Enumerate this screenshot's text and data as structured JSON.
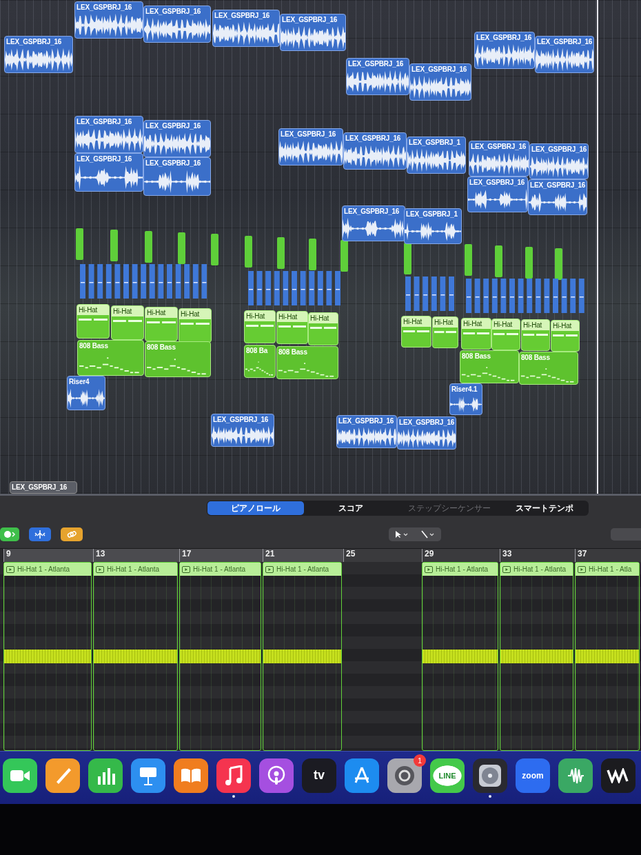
{
  "arrange": {
    "regions": [
      {
        "kind": "audio",
        "name": "LEX_GSPBRJ_16"
      },
      {
        "kind": "audio",
        "name": "LEX_GSPBRJ_16"
      },
      {
        "kind": "audio",
        "name": "LEX_GSPBRJ_16"
      },
      {
        "kind": "audio",
        "name": "LEX_GSPBRJ_16"
      },
      {
        "kind": "audio",
        "name": "LEX_GSPBRJ_16"
      },
      {
        "kind": "audio",
        "name": "LEX_GSPBRJ_16"
      },
      {
        "kind": "audio",
        "name": "LEX_GSPBRJ_16"
      },
      {
        "kind": "audio",
        "name": "LEX_GSPBRJ_16"
      },
      {
        "kind": "audio",
        "name": "LEX_GSPBRJ_16"
      },
      {
        "kind": "audio",
        "name": "LEX_GSPBRJ_16"
      },
      {
        "kind": "audio",
        "name": "LEX_GSPBRJ_16"
      },
      {
        "kind": "audio",
        "name": "LEX_GSPBRJ_16"
      },
      {
        "kind": "audio",
        "name": "LEX_GSPBRJ_16"
      },
      {
        "kind": "audio",
        "name": "LEX_GSPBRJ_16"
      },
      {
        "kind": "audio",
        "name": "LEX_GSPBRJ_16"
      },
      {
        "kind": "audio",
        "name": "LEX_GSPBRJ_1"
      },
      {
        "kind": "audio",
        "name": "LEX_GSPBRJ_16"
      },
      {
        "kind": "audio",
        "name": "LEX_GSPBRJ_16"
      },
      {
        "kind": "audio",
        "name": "LEX_GSPBRJ_16"
      },
      {
        "kind": "audio",
        "name": "LEX_GSPBRJ_16"
      },
      {
        "kind": "audio",
        "name": "LEX_GSPBRJ_16"
      },
      {
        "kind": "audio",
        "name": "LEX_GSPBRJ_1"
      },
      {
        "kind": "audio",
        "name": "LEX_GSPBRJ_16"
      },
      {
        "kind": "audio",
        "name": "LEX_GSPBRJ_16"
      },
      {
        "kind": "audio",
        "name": "LEX_GSPBRJ_16"
      },
      {
        "kind": "riser",
        "name": "Riser4"
      },
      {
        "kind": "riser",
        "name": "Riser4.1"
      },
      {
        "kind": "hihat",
        "name": "Hi-Hat"
      },
      {
        "kind": "hihat",
        "name": "Hi-Hat"
      },
      {
        "kind": "hihat",
        "name": "Hi-Hat"
      },
      {
        "kind": "hihat",
        "name": "Hi-Hat"
      },
      {
        "kind": "hihat",
        "name": "Hi-Hat"
      },
      {
        "kind": "hihat",
        "name": "Hi-Hat"
      },
      {
        "kind": "hihat",
        "name": "Hi-Hat"
      },
      {
        "kind": "hihat",
        "name": "Hi-Hat"
      },
      {
        "kind": "hihat",
        "name": "Hi-Hat"
      },
      {
        "kind": "hihat",
        "name": "Hi-Hat"
      },
      {
        "kind": "hihat",
        "name": "Hi-Hat"
      },
      {
        "kind": "hihat",
        "name": "Hi-Hat"
      },
      {
        "kind": "hihat",
        "name": "Hi-Hat"
      },
      {
        "kind": "bass",
        "name": "808 Bass"
      },
      {
        "kind": "bass",
        "name": "808 Bass"
      },
      {
        "kind": "bass",
        "name": "808 Ba"
      },
      {
        "kind": "bass",
        "name": "808 Bass"
      },
      {
        "kind": "bass",
        "name": "808 Bass"
      },
      {
        "kind": "bass",
        "name": "808 Bass"
      },
      {
        "kind": "label",
        "name": "LEX_GSPBRJ_16"
      }
    ]
  },
  "editor": {
    "tabs": [
      {
        "label": "ピアノロール",
        "selected": true,
        "disabled": false
      },
      {
        "label": "スコア",
        "selected": false,
        "disabled": false
      },
      {
        "label": "ステップシーケンサー",
        "selected": false,
        "disabled": true
      },
      {
        "label": "スマートテンポ",
        "selected": false,
        "disabled": false
      }
    ],
    "ruler": [
      "9",
      "13",
      "17",
      "21",
      "25",
      "29",
      "33",
      "37"
    ],
    "regions": [
      {
        "name": "Hi-Hat 1 - Atlanta"
      },
      {
        "name": "Hi-Hat 1 - Atlanta"
      },
      {
        "name": "Hi-Hat 1 - Atlanta"
      },
      {
        "name": "Hi-Hat 1 - Atlanta"
      },
      {
        "name": "Hi-Hat 1 - Atlanta"
      },
      {
        "name": "Hi-Hat 1 - Atlanta"
      },
      {
        "name": "Hi-Hat 1 - Atla"
      }
    ]
  },
  "dock": {
    "items": [
      {
        "kind": "camera",
        "running": false
      },
      {
        "kind": "pencil",
        "running": false
      },
      {
        "kind": "chart",
        "running": false
      },
      {
        "kind": "podium",
        "running": false
      },
      {
        "kind": "book",
        "running": false
      },
      {
        "kind": "music",
        "running": true
      },
      {
        "kind": "podcast",
        "running": false
      },
      {
        "kind": "tv",
        "text": "tv",
        "running": false
      },
      {
        "kind": "store",
        "running": false
      },
      {
        "kind": "gear",
        "badge": "1",
        "running": false
      },
      {
        "kind": "chat",
        "text": "LINE",
        "running": false
      },
      {
        "kind": "disc",
        "running": true
      },
      {
        "kind": "video",
        "text": "zoom",
        "running": false
      },
      {
        "kind": "waveform",
        "running": false
      },
      {
        "kind": "wave",
        "running": false
      }
    ]
  }
}
